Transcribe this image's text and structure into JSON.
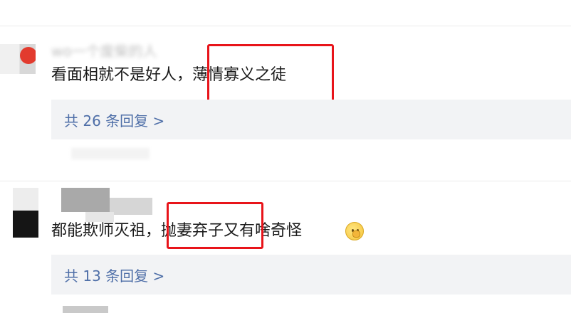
{
  "comments": [
    {
      "username": "wo一个废柴的人",
      "text_before": "看面相就不是好人，",
      "text_highlight": "薄情寡义之徒",
      "text_after": "",
      "reply_label": "共 26 条回复 >"
    },
    {
      "username": "",
      "text_before": "都能欺师灭祖，",
      "text_highlight": "抛妻弃子",
      "text_after": "又有啥奇怪",
      "emoji": "thinking-face-emoji",
      "reply_label": "共 13 条回复 >"
    }
  ],
  "colors": {
    "highlight_border": "#e8141a",
    "reply_text": "#4f6fa8",
    "reply_bg": "#f2f3f5"
  }
}
